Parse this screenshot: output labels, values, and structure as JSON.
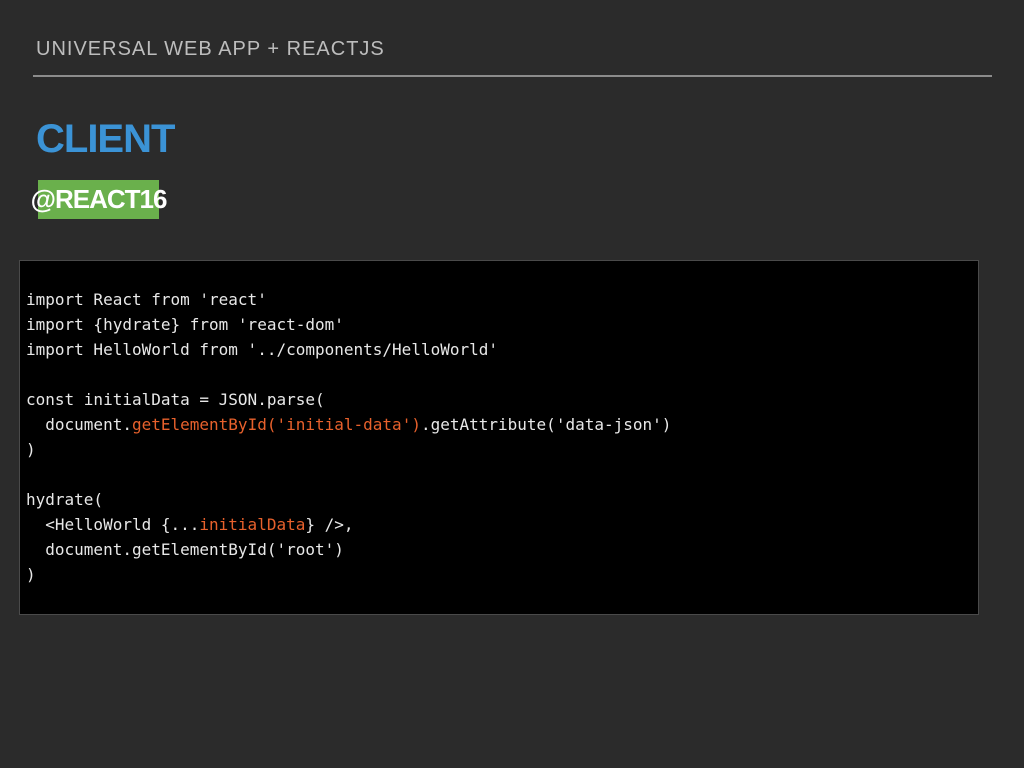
{
  "header": {
    "title": "UNIVERSAL WEB APP + REACTJS"
  },
  "slide": {
    "title": "CLIENT",
    "badge": "@REACT16"
  },
  "colors": {
    "background": "#2b2b2b",
    "title": "#3b93d6",
    "badge": "#6ab04c",
    "highlight": "#e8612c"
  },
  "code": {
    "lines": [
      {
        "segments": [
          {
            "text": "import React from 'react'"
          }
        ]
      },
      {
        "segments": [
          {
            "text": "import {hydrate} from 'react-dom'"
          }
        ]
      },
      {
        "segments": [
          {
            "text": "import HelloWorld from '../components/HelloWorld'"
          }
        ]
      },
      {
        "segments": [
          {
            "text": ""
          }
        ]
      },
      {
        "segments": [
          {
            "text": "const initialData = JSON.parse("
          }
        ]
      },
      {
        "segments": [
          {
            "text": "  document."
          },
          {
            "text": "getElementById('initial-data')",
            "highlight": true
          },
          {
            "text": ".getAttribute('data-json')"
          }
        ]
      },
      {
        "segments": [
          {
            "text": ")"
          }
        ]
      },
      {
        "segments": [
          {
            "text": ""
          }
        ]
      },
      {
        "segments": [
          {
            "text": "hydrate("
          }
        ]
      },
      {
        "segments": [
          {
            "text": "  <HelloWorld {..."
          },
          {
            "text": "initialData",
            "highlight": true
          },
          {
            "text": "} />,"
          }
        ]
      },
      {
        "segments": [
          {
            "text": "  document.getElementById('root')"
          }
        ]
      },
      {
        "segments": [
          {
            "text": ")"
          }
        ]
      }
    ]
  }
}
